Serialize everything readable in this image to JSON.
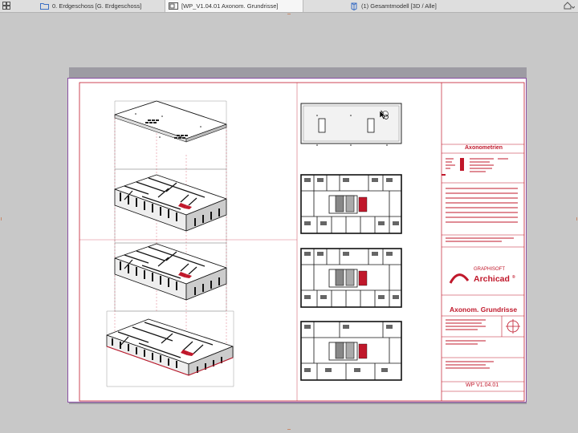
{
  "tabs": [
    {
      "label": "0. Erdgeschoss [G. Erdgeschoss]",
      "active": false
    },
    {
      "label": "[WP_V1.04.01 Axonom. Grundrisse]",
      "active": true
    },
    {
      "label": "(1) Gesamtmodell [3D / Alle]",
      "active": false
    }
  ],
  "title_block": {
    "heading": "Axonometrien",
    "brand_top": "GRAPHISOFT",
    "brand_main": "Archicad",
    "brand_mark": "®",
    "drawing_title": "Axonom. Grundrisse",
    "sheet_id": "WP  V1.04.01"
  },
  "colors": {
    "accent_red": "#c0182b",
    "sheet_border": "#8a4fa3",
    "canvas_bg": "#c8c8c8"
  },
  "icons": [
    "sidebar-layout-icon",
    "folder-icon",
    "layout-sheet-icon",
    "3d-model-icon",
    "home-menu-icon"
  ]
}
